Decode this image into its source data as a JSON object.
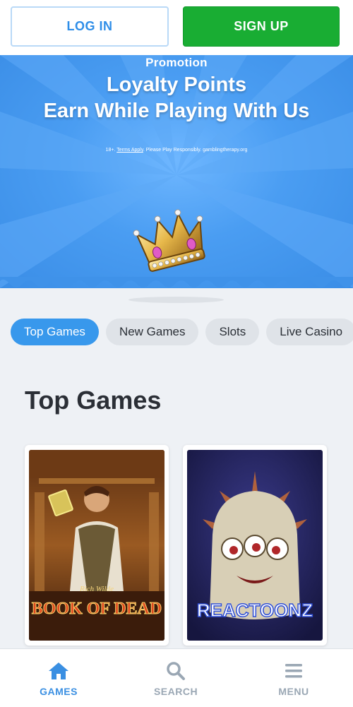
{
  "auth": {
    "login_label": "LOG IN",
    "signup_label": "SIGN UP"
  },
  "promo": {
    "label": "Promotion",
    "title_line1": "Loyalty Points",
    "title_line2": "Earn While Playing With Us",
    "terms_prefix": "18+.",
    "terms_link": "Terms Apply",
    "terms_suffix": ". Please Play Responsibly. gamblingtherapy.org"
  },
  "categories": [
    {
      "label": "Top Games",
      "active": true
    },
    {
      "label": "New Games",
      "active": false
    },
    {
      "label": "Slots",
      "active": false
    },
    {
      "label": "Live Casino",
      "active": false
    }
  ],
  "section_title": "Top Games",
  "games": [
    {
      "title_small": "Rich Wilde",
      "title": "BOOK OF DEAD"
    },
    {
      "title": "REACTOONZ"
    }
  ],
  "bottom_nav": [
    {
      "label": "GAMES",
      "icon": "home-icon",
      "active": true
    },
    {
      "label": "SEARCH",
      "icon": "search-icon",
      "active": false
    },
    {
      "label": "MENU",
      "icon": "hamburger-icon",
      "active": false
    }
  ],
  "colors": {
    "accent_blue": "#3898ec",
    "signup_green": "#19ad33",
    "promo_blue": "#4a9df2",
    "nav_inactive": "#9aa7b4"
  }
}
